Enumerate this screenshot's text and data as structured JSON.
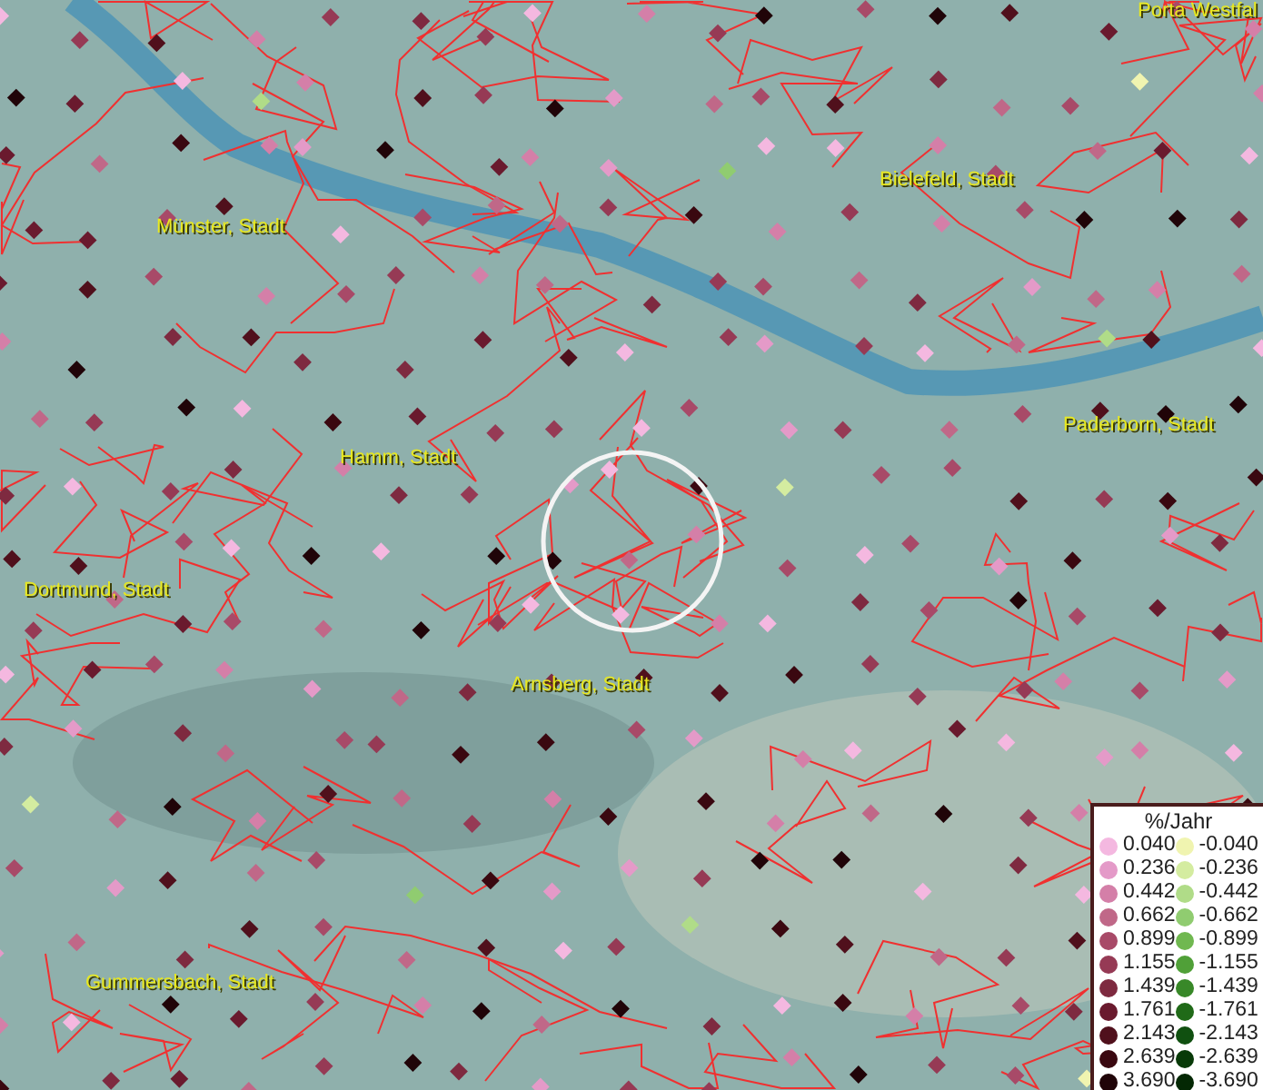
{
  "map": {
    "labels": [
      {
        "text": "Porta Westfal"
      },
      {
        "text": "Münster, Stadt"
      },
      {
        "text": "Bielefeld, Stadt"
      },
      {
        "text": "Hamm, Stadt"
      },
      {
        "text": "Paderborn, Stadt"
      },
      {
        "text": "Dortmund, Stadt"
      },
      {
        "text": "Arnsberg, Stadt"
      },
      {
        "text": "Gummersbach, Stadt"
      }
    ]
  },
  "legend": {
    "title": "%/Jahr",
    "rows": [
      {
        "positive": {
          "label": "0.040",
          "color": "#f4b8e0"
        },
        "negative": {
          "label": "-0.040",
          "color": "#f0f4b0"
        }
      },
      {
        "positive": {
          "label": "0.236",
          "color": "#e49ac8"
        },
        "negative": {
          "label": "-0.236",
          "color": "#d4eca0"
        }
      },
      {
        "positive": {
          "label": "0.442",
          "color": "#d47fa8"
        },
        "negative": {
          "label": "-0.442",
          "color": "#b0dc88"
        }
      },
      {
        "positive": {
          "label": "0.662",
          "color": "#c06888"
        },
        "negative": {
          "label": "-0.662",
          "color": "#90cc70"
        }
      },
      {
        "positive": {
          "label": "0.899",
          "color": "#a84a68"
        },
        "negative": {
          "label": "-0.899",
          "color": "#70b850"
        }
      },
      {
        "positive": {
          "label": "1.155",
          "color": "#963a55"
        },
        "negative": {
          "label": "-1.155",
          "color": "#50a038"
        }
      },
      {
        "positive": {
          "label": "1.439",
          "color": "#7e2a40"
        },
        "negative": {
          "label": "-1.439",
          "color": "#388828"
        }
      },
      {
        "positive": {
          "label": "1.761",
          "color": "#6a1a2e"
        },
        "negative": {
          "label": "-1.761",
          "color": "#206a18"
        }
      },
      {
        "positive": {
          "label": "2.143",
          "color": "#50101c"
        },
        "negative": {
          "label": "-2.143",
          "color": "#105010"
        }
      },
      {
        "positive": {
          "label": "2.639",
          "color": "#3a0810"
        },
        "negative": {
          "label": "-2.639",
          "color": "#083a08"
        }
      },
      {
        "positive": {
          "label": "3.690",
          "color": "#200408"
        },
        "negative": {
          "label": "-3.690",
          "color": "#042804"
        }
      }
    ]
  }
}
